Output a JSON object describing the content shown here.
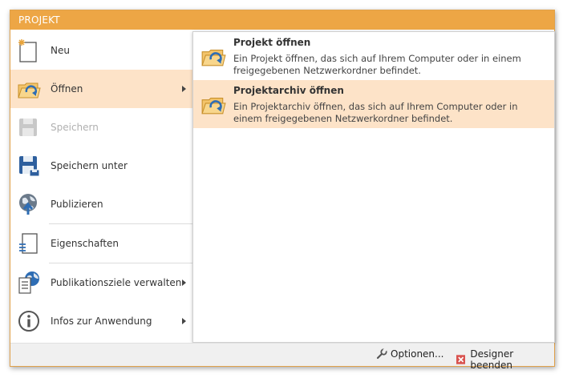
{
  "window": {
    "title": "PROJEKT"
  },
  "menu": {
    "items": [
      {
        "label": "Neu",
        "icon": "new-document-icon"
      },
      {
        "label": "Öffnen",
        "icon": "open-folder-icon",
        "active": true
      },
      {
        "label": "Speichern",
        "icon": "save-icon",
        "disabled": true
      },
      {
        "label": "Speichern unter",
        "icon": "save-as-icon"
      },
      {
        "label": "Publizieren",
        "icon": "publish-globe-icon"
      },
      {
        "label": "Eigenschaften",
        "icon": "properties-document-icon"
      },
      {
        "label": "Publikationsziele verwalten",
        "icon": "publication-targets-icon"
      },
      {
        "label": "Infos zur Anwendung",
        "icon": "info-icon"
      }
    ]
  },
  "submenu": {
    "items": [
      {
        "title": "Projekt öffnen",
        "desc": "Ein Projekt öffnen, das sich auf Ihrem Computer oder in einem freigegebenen Netzwerkordner befindet.",
        "icon": "open-folder-icon"
      },
      {
        "title": "Projektarchiv öffnen",
        "desc": "Ein Projektarchiv öffnen, das sich auf Ihrem Computer oder in einem freigegebenen Netzwerkordner befindet.",
        "icon": "open-archive-folder-icon"
      }
    ]
  },
  "footer": {
    "options_label": "Optionen...",
    "exit_label": "Designer beenden"
  },
  "colors": {
    "titlebar": "#eda645",
    "highlight": "#fde3c8",
    "accent_blue": "#2e6db4",
    "exit_red": "#d9534f"
  }
}
